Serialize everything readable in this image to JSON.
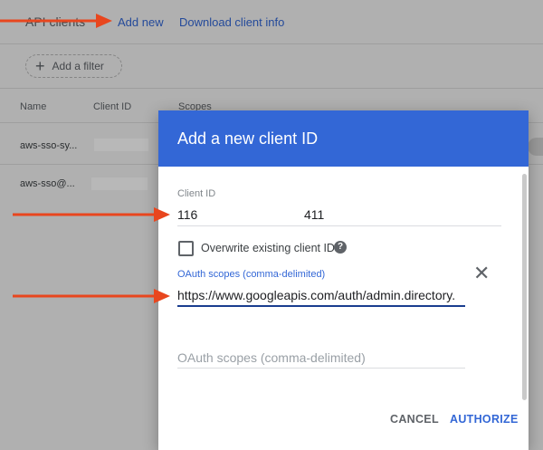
{
  "background": {
    "page_title": "API clients",
    "links": {
      "add_new": "Add new",
      "download": "Download client info"
    },
    "filter": {
      "label": "Add a filter"
    },
    "table": {
      "columns": [
        "Name",
        "Client ID",
        "Scopes"
      ],
      "rows": [
        {
          "name": "aws-sso-sy..."
        },
        {
          "name": "aws-sso@..."
        }
      ]
    }
  },
  "dialog": {
    "title": "Add a new client ID",
    "client_id": {
      "label": "Client ID",
      "value_part1": "116",
      "value_part2": "411"
    },
    "overwrite": {
      "label": "Overwrite existing client ID",
      "checked": false
    },
    "scopes": {
      "label": "OAuth scopes (comma-delimited)",
      "value": "https://www.googleapis.com/auth/admin.directory.",
      "placeholder": "OAuth scopes (comma-delimited)"
    },
    "buttons": {
      "cancel": "CANCEL",
      "authorize": "AUTHORIZE"
    }
  },
  "colors": {
    "accent": "#3367d6",
    "annotation": "#e8461e"
  }
}
